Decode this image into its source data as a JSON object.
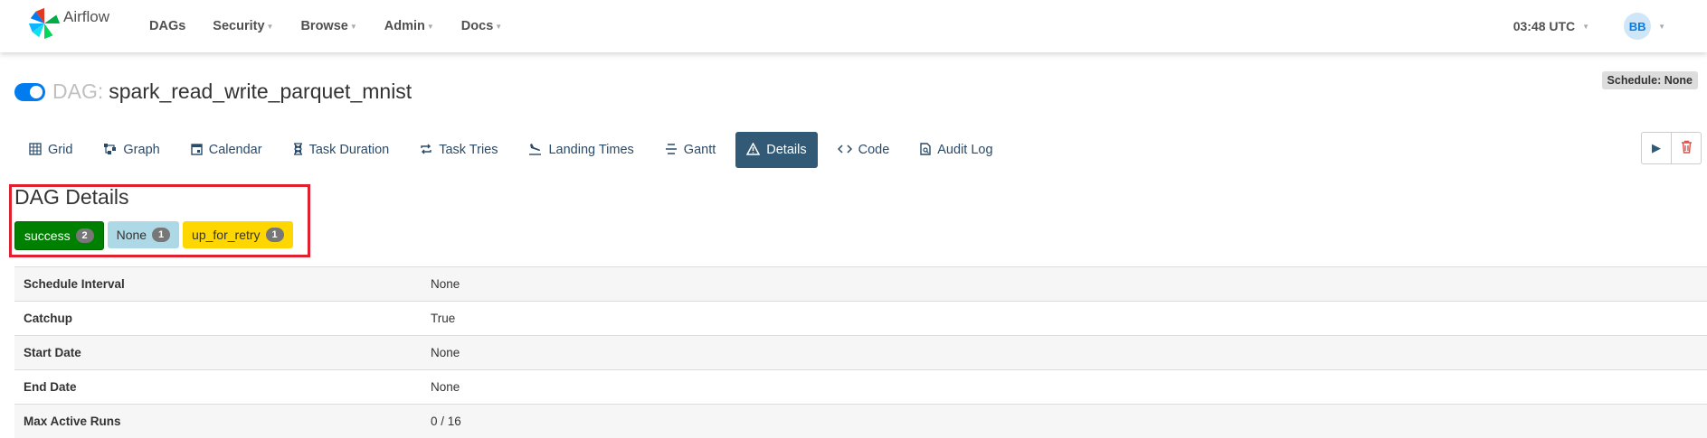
{
  "nav": {
    "brand": "Airflow",
    "items": [
      {
        "label": "DAGs",
        "dropdown": false
      },
      {
        "label": "Security",
        "dropdown": true
      },
      {
        "label": "Browse",
        "dropdown": true
      },
      {
        "label": "Admin",
        "dropdown": true
      },
      {
        "label": "Docs",
        "dropdown": true
      }
    ],
    "time": "03:48 UTC",
    "user_initials": "BB"
  },
  "header": {
    "dag_label": "DAG:",
    "dag_id": "spark_read_write_parquet_mnist",
    "schedule": "Schedule: None",
    "paused": false
  },
  "tabs": [
    {
      "label": "Grid",
      "icon": "grid-icon",
      "active": false
    },
    {
      "label": "Graph",
      "icon": "graph-icon",
      "active": false
    },
    {
      "label": "Calendar",
      "icon": "calendar-icon",
      "active": false
    },
    {
      "label": "Task Duration",
      "icon": "hourglass-icon",
      "active": false
    },
    {
      "label": "Task Tries",
      "icon": "repeat-icon",
      "active": false
    },
    {
      "label": "Landing Times",
      "icon": "plane-landing-icon",
      "active": false
    },
    {
      "label": "Gantt",
      "icon": "gantt-icon",
      "active": false
    },
    {
      "label": "Details",
      "icon": "warning-icon",
      "active": true
    },
    {
      "label": "Code",
      "icon": "code-icon",
      "active": false
    },
    {
      "label": "Audit Log",
      "icon": "audit-log-icon",
      "active": false
    }
  ],
  "details": {
    "title": "DAG Details",
    "states": [
      {
        "label": "success",
        "count": "2",
        "color": "#008000"
      },
      {
        "label": "None",
        "count": "1",
        "color": "#add8e6"
      },
      {
        "label": "up_for_retry",
        "count": "1",
        "color": "#ffd700"
      }
    ],
    "rows": [
      {
        "key": "Schedule Interval",
        "value": "None"
      },
      {
        "key": "Catchup",
        "value": "True"
      },
      {
        "key": "Start Date",
        "value": "None"
      },
      {
        "key": "End Date",
        "value": "None"
      },
      {
        "key": "Max Active Runs",
        "value": "0 / 16"
      }
    ]
  }
}
